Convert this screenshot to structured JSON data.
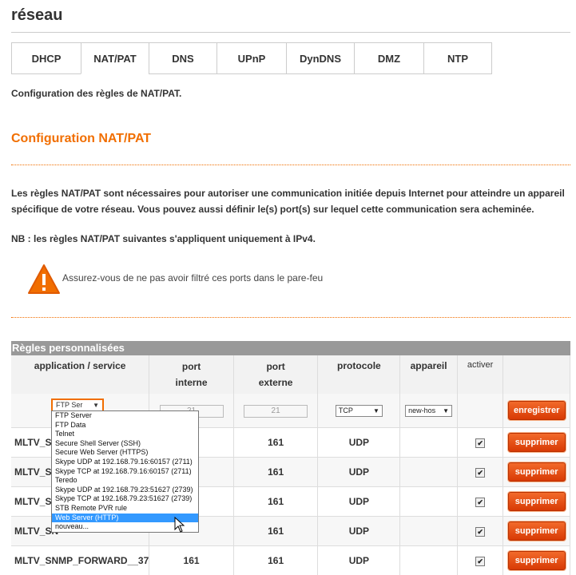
{
  "page_title": "réseau",
  "tabs": [
    {
      "label": "DHCP",
      "active": false
    },
    {
      "label": "NAT/PAT",
      "active": true
    },
    {
      "label": "DNS",
      "active": false
    },
    {
      "label": "UPnP",
      "active": false
    },
    {
      "label": "DynDNS",
      "active": false
    },
    {
      "label": "DMZ",
      "active": false
    },
    {
      "label": "NTP",
      "active": false
    }
  ],
  "intro": "Configuration des règles de NAT/PAT.",
  "section_title": "Configuration NAT/PAT",
  "description": "Les règles NAT/PAT sont nécessaires pour autoriser une communication initiée depuis Internet pour atteindre un appareil spécifique de votre réseau. Vous pouvez aussi définir le(s) port(s) sur lequel cette communication sera acheminée.",
  "nb": "NB : les règles NAT/PAT suivantes s'appliquent uniquement à IPv4.",
  "warning": "Assurez-vous de ne pas avoir filtré ces ports dans le pare-feu",
  "table": {
    "title": "Règles personnalisées",
    "headers": {
      "service": "application / service",
      "port_interne_1": "port",
      "port_interne_2": "interne",
      "port_externe_1": "port",
      "port_externe_2": "externe",
      "protocole": "protocole",
      "appareil": "appareil",
      "activer": "activer"
    },
    "edit_row": {
      "service_value": "FTP Ser",
      "port_interne_placeholder": "21",
      "port_externe_placeholder": "21",
      "protocole_value": "TCP",
      "appareil_value": "new-hos",
      "button": "enregistrer"
    },
    "rows": [
      {
        "name": "MLTV_SNM",
        "port_interne": "",
        "port_externe": "161",
        "protocole": "UDP",
        "checked": true,
        "button": "supprimer"
      },
      {
        "name": "MLTV_SN",
        "port_interne": "",
        "port_externe": "161",
        "protocole": "UDP",
        "checked": true,
        "button": "supprimer"
      },
      {
        "name": "MLTV_SN",
        "port_interne": "",
        "port_externe": "161",
        "protocole": "UDP",
        "checked": true,
        "button": "supprimer"
      },
      {
        "name": "MLTV_SN",
        "port_interne": "",
        "port_externe": "161",
        "protocole": "UDP",
        "checked": true,
        "button": "supprimer"
      },
      {
        "name": "MLTV_SNMP_FORWARD__37",
        "port_interne": "161",
        "port_externe": "161",
        "protocole": "UDP",
        "checked": true,
        "button": "supprimer"
      }
    ]
  },
  "dropdown_options": [
    "FTP Server",
    "FTP Data",
    "Telnet",
    "Secure Shell Server (SSH)",
    "Secure Web Server (HTTPS)",
    "Skype UDP at 192.168.79.16:60157 (2711)",
    "Skype TCP at 192.168.79.16:60157 (2711)",
    "Teredo",
    "Skype UDP at 192.168.79.23:51627 (2739)",
    "Skype TCP at 192.168.79.23:51627 (2739)",
    "STB Remote PVR rule",
    "Web Server (HTTP)",
    "nouveau..."
  ],
  "dropdown_highlighted": "Web Server (HTTP)",
  "colors": {
    "accent": "#f16e00",
    "button": "#e0400a",
    "highlight": "#3399ff"
  }
}
